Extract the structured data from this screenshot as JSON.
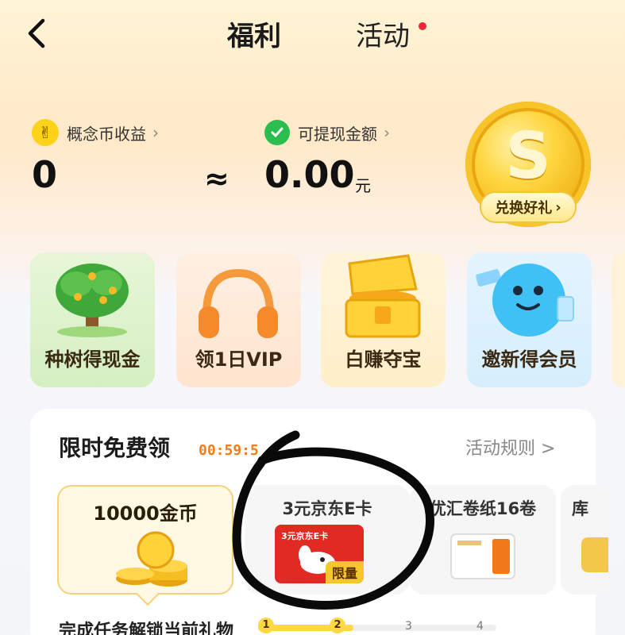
{
  "header": {
    "tab_welfare": "福利",
    "tab_activity": "活动"
  },
  "earnings": {
    "coin_label": "概念币收益",
    "coin_value": "0",
    "approx": "≈",
    "cash_label": "可提现金额",
    "cash_value": "0.00",
    "cash_unit": "元",
    "exchange_label": "兑换好礼",
    "chevron": "›"
  },
  "features": [
    {
      "label": "种树得现金",
      "icon": "tree-icon"
    },
    {
      "label": "领1日VIP",
      "icon": "headphones-icon"
    },
    {
      "label": "白赚夺宝",
      "icon": "treasure-chest-icon"
    },
    {
      "label": "邀新得会员",
      "icon": "mascot-icon"
    }
  ],
  "free_gifts": {
    "title": "限时免费领",
    "timer": "00:59:5",
    "rules_label": "活动规则 >",
    "gifts": [
      {
        "name": "10000金币",
        "icon": "gold-coins-icon"
      },
      {
        "name": "3元京东E卡",
        "icon": "jd-card-icon",
        "card_text": "3元京东E卡",
        "tag": "限量"
      },
      {
        "name": "优汇卷纸16卷",
        "icon": "tissue-icon"
      },
      {
        "name": "库",
        "icon": "gift-icon"
      }
    ],
    "unlock_label": "完成任务解锁当前礼物",
    "steps": [
      "1",
      "2",
      "3",
      "4"
    ],
    "progress_fraction": 0.4
  },
  "colors": {
    "accent_orange": "#f47c1a",
    "coin_gold": "#ffd21a",
    "wechat_green": "#2bbd4e",
    "jd_red": "#e02a22",
    "dot_red": "#e8283c"
  }
}
